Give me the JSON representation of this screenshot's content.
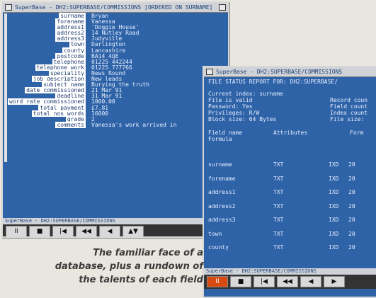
{
  "window1": {
    "title": "SuperBase - DH2:SUPERBASE/COMMISSIONS [ORDERED ON SURNAME]",
    "fields": [
      {
        "label": "surname",
        "value": "Bryan"
      },
      {
        "label": "forename",
        "value": "Vanessa"
      },
      {
        "label": "address1",
        "value": "'Doggie House'"
      },
      {
        "label": "address2",
        "value": "14 Nutley Road"
      },
      {
        "label": "address3",
        "value": "Judyville"
      },
      {
        "label": "town",
        "value": "Darlington"
      },
      {
        "label": "county",
        "value": "Lancashire"
      },
      {
        "label": "postcode",
        "value": "BA14 4QE"
      },
      {
        "label": "telephone",
        "value": "01225 442244"
      },
      {
        "label": "telephone work",
        "value": "01225 777766"
      },
      {
        "label": "speciality",
        "value": "News Round"
      },
      {
        "label": "job description",
        "value": "New leads"
      },
      {
        "label": "subject name",
        "value": "Burying the truth"
      },
      {
        "label": "date commissioned",
        "value": "21 Mar 91"
      },
      {
        "label": "deadline",
        "value": "31 Mar 91"
      },
      {
        "label": "word rate commissioned",
        "value": "1000.00"
      },
      {
        "label": "total payment",
        "value": "£7.81"
      },
      {
        "label": "total nos words",
        "value": "16000"
      },
      {
        "label": "grade",
        "value": "2"
      },
      {
        "label": "comments",
        "value": "Vanessa's work arrived in"
      }
    ],
    "status": "SuperBase - DH2:SUPERBASE/COMMISSIONS",
    "controls": [
      "II",
      "■",
      "|◀",
      "◀◀",
      "◀",
      "▲▼"
    ]
  },
  "window2": {
    "title": "SuperBase - DH2:SUPERBASE/COMMISSIONS",
    "report_title": "FILE STATUS REPORT FOR: DH2:SUPERBASE/",
    "info": [
      {
        "left": "Current index:  surname",
        "right": ""
      },
      {
        "left": "File is valid",
        "right": "Record coun"
      },
      {
        "left": "Password:       Yes",
        "right": "Field count"
      },
      {
        "left": "Privileges:     R/W",
        "right": "Index count"
      },
      {
        "left": "Block size:     64 Bytes",
        "right": "File size:"
      }
    ],
    "table_headers": {
      "field": "Field name",
      "field2": "Formula",
      "attr": "Attributes",
      "form": "Form"
    },
    "rows": [
      {
        "name": "surname",
        "type": "TXT",
        "idx": "IXD",
        "len": "20"
      },
      {
        "name": "forename",
        "type": "TXT",
        "idx": "IXD",
        "len": "20"
      },
      {
        "name": "address1",
        "type": "TXT",
        "idx": "IXD",
        "len": "20"
      },
      {
        "name": "address2",
        "type": "TXT",
        "idx": "IXD",
        "len": "20"
      },
      {
        "name": "address3",
        "type": "TXT",
        "idx": "IXD",
        "len": "20"
      },
      {
        "name": "town",
        "type": "TXT",
        "idx": "IXD",
        "len": "20"
      },
      {
        "name": "county",
        "type": "TXT",
        "idx": "IXD",
        "len": "20"
      }
    ],
    "status": "SuperBase - DH2:SUPERBASE/COMMISSIONS",
    "controls": [
      "II",
      "■",
      "|◀",
      "◀◀",
      "◀",
      "▶"
    ]
  },
  "caption": {
    "line1": "The familiar face of a",
    "line2": "database, plus a rundown of",
    "line3": "the talents of each field"
  }
}
